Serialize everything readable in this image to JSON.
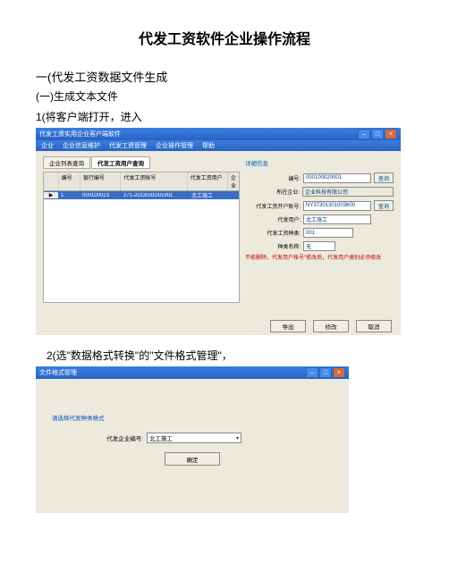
{
  "doc": {
    "title": "代发工资软件企业操作流程",
    "h1": "一(代发工资数据文件生成",
    "h1_1": "(一)生成文本文件",
    "step1": "1(将客户端打开，进入",
    "step2": "2(选\"数据格式转换\"的\"文件格式管理\"，"
  },
  "win1": {
    "title": "代发工资实用企业客户端软件",
    "menu": [
      "企业",
      "企业信息维护",
      "代发工资管理",
      "企业操作管理",
      "帮助"
    ],
    "tabs": [
      "企业列表查询",
      "代发工资用户查询"
    ],
    "cols": [
      "",
      "编号",
      "银行编号",
      "代发工资帐号",
      "代发工资用户",
      "企业"
    ],
    "row": {
      "arrow": "▶",
      "id": "1",
      "bank": "000100023",
      "acc": "271-2013031001901",
      "user": "北工施工",
      "ent": ""
    },
    "rp_title": "详细信息",
    "f_id_lbl": "编号:",
    "f_id_val": "000100020001",
    "f_id_btn": "查询",
    "f_ent_lbl": "所在企业:",
    "f_ent_val": "企业科技有限公司",
    "f_acc_lbl": "代发工资开户账号:",
    "f_acc_val": "NY37301301003600",
    "f_acc_btn": "查询",
    "f_user_lbl": "代发用户:",
    "f_user_val": "北工施工",
    "f_cat_lbl": "代发工资种类:",
    "f_cat_val": "001",
    "f_catname_lbl": "种类名称:",
    "f_catname_val": "无",
    "note": "不能删除，代发用户帐号\"修改后，代发用户类别必须修改",
    "btns": [
      "导出",
      "修改",
      "取消"
    ]
  },
  "win2": {
    "title": "文件格式管理",
    "info": "请选择代发种类格式",
    "sel_lbl": "代发企业编号:",
    "sel_val": "北工施工",
    "ok": "确定"
  }
}
